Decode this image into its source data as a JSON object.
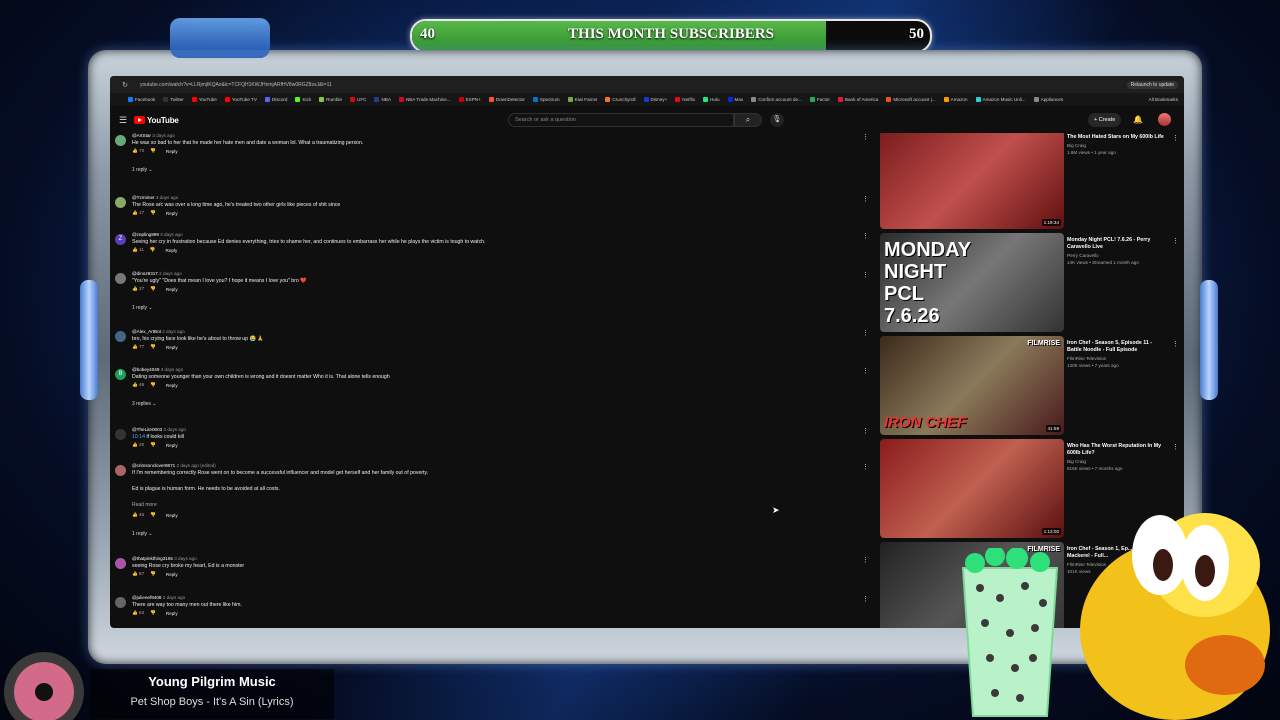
{
  "stream": {
    "sub_goal": {
      "current": "40",
      "goal": "50",
      "title": "THIS MONTH SUBSCRIBERS",
      "progress": 0.8
    },
    "now_playing": {
      "artist": "Young Pilgrim Music",
      "song": "Pet Shop Boys - It's A Sin (Lyrics)"
    },
    "disc_label": "Pet Shop Boys"
  },
  "browser": {
    "url": "youtube.com/watch?v=LLRjmjIKQAo&lc=TCFQH1KWJHnmjARfHV8w0RGZ8sxJ&t=11",
    "relaunch": "Relaunch to update",
    "bookmarks": [
      {
        "label": "Facebook",
        "color": "#1877f2"
      },
      {
        "label": "Twitter",
        "color": "#333"
      },
      {
        "label": "YouTube",
        "color": "#f00"
      },
      {
        "label": "YouTube TV",
        "color": "#f00"
      },
      {
        "label": "Discord",
        "color": "#5865f2"
      },
      {
        "label": "Kick",
        "color": "#53fc18"
      },
      {
        "label": "Rumble",
        "color": "#85c742"
      },
      {
        "label": "UFC",
        "color": "#d20a0a"
      },
      {
        "label": "NBA",
        "color": "#1d428a"
      },
      {
        "label": "NBA Trade Machine...",
        "color": "#c9082a"
      },
      {
        "label": "ESPN+",
        "color": "#c00"
      },
      {
        "label": "DownDetector",
        "color": "#e53"
      },
      {
        "label": "Spectrum",
        "color": "#0077c8"
      },
      {
        "label": "Kiwi Farms",
        "color": "#7a4"
      },
      {
        "label": "Crunchyroll",
        "color": "#f47521"
      },
      {
        "label": "Disney+",
        "color": "#113ccf"
      },
      {
        "label": "Netflix",
        "color": "#e50914"
      },
      {
        "label": "Hulu",
        "color": "#1ce783"
      },
      {
        "label": "Max",
        "color": "#002be7"
      },
      {
        "label": "Confirm account de...",
        "color": "#888"
      },
      {
        "label": "Factor",
        "color": "#2a6"
      },
      {
        "label": "Bank of America",
        "color": "#e31837"
      },
      {
        "label": "Microsoft account |...",
        "color": "#f25022"
      },
      {
        "label": "Amazon",
        "color": "#f90"
      },
      {
        "label": "Amazon Music Unli...",
        "color": "#25d1da"
      },
      {
        "label": "Appliances",
        "color": "#888"
      }
    ],
    "all_bookmarks": "All Bookmarks"
  },
  "youtube": {
    "logo": "YouTube",
    "search_placeholder": "Search or ask a question",
    "create": "Create"
  },
  "comments": [
    {
      "handle": "@ArtStar",
      "date": "3 days ago",
      "text": "He was so bad to her that he made her hate men and date a woman lol. What a traumatizing person.",
      "likes": "70",
      "replies": "1 reply",
      "avatar": "#6a7",
      "initial": ""
    },
    {
      "handle": "@Tzmimer",
      "date": "3 days ago",
      "text": "The Rose arc was over a long time ago, he's treated two other girls like pieces of shit since",
      "likes": "17",
      "replies": "",
      "avatar": "#8a6",
      "initial": ""
    },
    {
      "handle": "@zepling999",
      "date": "3 days ago",
      "text": "Seeing her cry in frustration because Ed denies everything, tries to shame her, and continues to embarrass her while he plays the victim is tough to watch.",
      "likes": "11",
      "replies": "",
      "avatar": "#5b3fb8",
      "initial": "Z"
    },
    {
      "handle": "@dinoz9317",
      "date": "2 days ago",
      "text": "\"You're ugly\" \"Does that mean I love you? I hope it means I love you\" bro ❤️",
      "likes": "27",
      "replies": "1 reply",
      "avatar": "#777",
      "initial": ""
    },
    {
      "handle": "@Alex_ArtBot",
      "date": "2 days ago",
      "text": "bro, his crying face look like he's about to throw up 😭 🙏",
      "likes": "77",
      "replies": "",
      "avatar": "#468",
      "initial": ""
    },
    {
      "handle": "@bobey4049",
      "date": "3 days ago",
      "text": "Dating someone younger than your own children is wrong and it doesnt matter Who it is. That alone tells enough",
      "likes": "46",
      "replies": "3 replies",
      "avatar": "#1b9e5a",
      "initial": "B"
    },
    {
      "handle": "@TheLite0003",
      "date": "2 days ago",
      "ts": "10:14",
      "text": "if looks could kill",
      "likes": "20",
      "replies": "",
      "avatar": "#333",
      "initial": ""
    },
    {
      "handle": "@crimsonclover9871",
      "date": "2 days ago (edited)",
      "text": "If I'm remembering correctly Rose went on to become a successful influencer and model get herself and her family out of poverty.",
      "text2": "Ed is plague is human form. He needs to be avoided at all costs.",
      "read_more": "Read more",
      "likes": "46",
      "replies": "1 reply",
      "avatar": "#a66",
      "initial": ""
    },
    {
      "handle": "@thatpinkthing3165",
      "date": "3 days ago",
      "text": "seeing Rose cry broke my heart, Ed is a monster",
      "likes": "87",
      "replies": "",
      "avatar": "#a5a",
      "initial": ""
    },
    {
      "handle": "@julienef9408",
      "date": "2 days ago",
      "text": "There are way too many men out there like him.",
      "likes": "54",
      "replies": "",
      "avatar": "#666",
      "initial": ""
    }
  ],
  "reply_label": "Reply",
  "sidebar": [
    {
      "title": "The Most Hated Stars on My 600lb Life",
      "channel": "Big Craig",
      "meta": "1.6M views • 1 year ago",
      "duration": "1:19:34",
      "thumb_text": ""
    },
    {
      "title": "Monday Night PCL! 7.6.26 - Perry Caravello Live",
      "channel": "Perry Caravello",
      "meta": "14K views • Streamed 1 month ago",
      "duration": "",
      "thumb_text": "MONDAY NIGHT PCL 7.6.26"
    },
    {
      "title": "Iron Chef - Season 5, Episode 11 - Battle Noodle - Full Episode",
      "channel": "FilmRise Television",
      "meta": "130K views • 7 years ago",
      "duration": "41:59",
      "thumb_text": "IRON CHEF",
      "thumb_brand": "FILMRISE"
    },
    {
      "title": "Who Has The Worst Reputation In My 600lb Life?",
      "channel": "Big Craig",
      "meta": "816K views • 7 months ago",
      "duration": "1:13:00",
      "thumb_text": ""
    },
    {
      "title": "Iron Chef - Season 1, Ep... Spanish Mackerel - Full...",
      "channel": "FilmRise Television",
      "meta": "101K views",
      "duration": "",
      "thumb_text": "",
      "thumb_brand": "FILMRISE"
    }
  ]
}
